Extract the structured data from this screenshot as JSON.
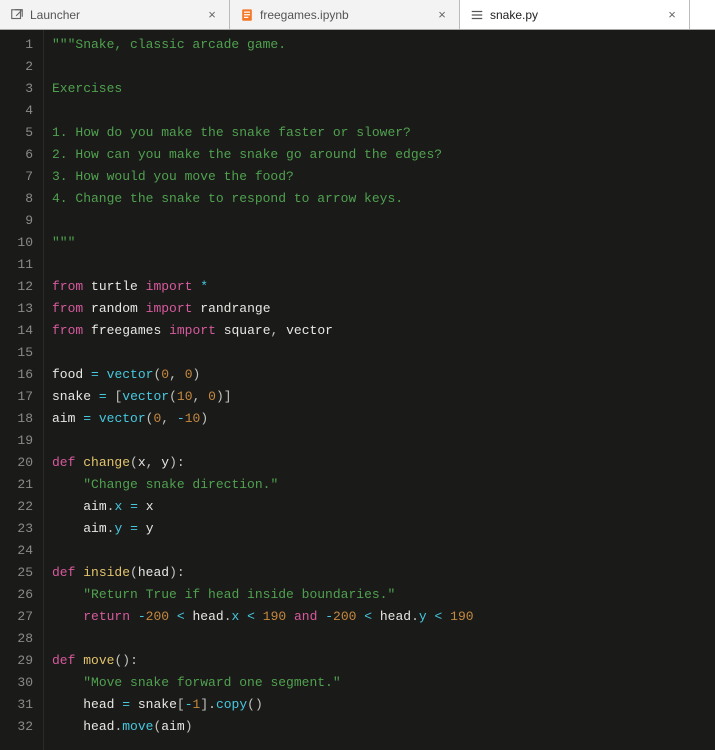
{
  "tabs": [
    {
      "label": "Launcher",
      "iconType": "launcher",
      "active": false
    },
    {
      "label": "freegames.ipynb",
      "iconType": "notebook",
      "active": false
    },
    {
      "label": "snake.py",
      "iconType": "python",
      "active": true
    }
  ],
  "code": {
    "language": "python",
    "lines": [
      {
        "n": 1,
        "tokens": [
          {
            "t": "\"\"\"Snake, classic arcade game.",
            "c": "str"
          }
        ]
      },
      {
        "n": 2,
        "tokens": []
      },
      {
        "n": 3,
        "tokens": [
          {
            "t": "Exercises",
            "c": "str"
          }
        ]
      },
      {
        "n": 4,
        "tokens": []
      },
      {
        "n": 5,
        "tokens": [
          {
            "t": "1. How do you make the snake faster or slower?",
            "c": "str"
          }
        ]
      },
      {
        "n": 6,
        "tokens": [
          {
            "t": "2. How can you make the snake go around the edges?",
            "c": "str"
          }
        ]
      },
      {
        "n": 7,
        "tokens": [
          {
            "t": "3. How would you move the food?",
            "c": "str"
          }
        ]
      },
      {
        "n": 8,
        "tokens": [
          {
            "t": "4. Change the snake to respond to arrow keys.",
            "c": "str"
          }
        ]
      },
      {
        "n": 9,
        "tokens": []
      },
      {
        "n": 10,
        "tokens": [
          {
            "t": "\"\"\"",
            "c": "str"
          }
        ]
      },
      {
        "n": 11,
        "tokens": []
      },
      {
        "n": 12,
        "tokens": [
          {
            "t": "from",
            "c": "kw"
          },
          {
            "t": " ",
            "c": ""
          },
          {
            "t": "turtle",
            "c": "mod"
          },
          {
            "t": " ",
            "c": ""
          },
          {
            "t": "import",
            "c": "kw"
          },
          {
            "t": " ",
            "c": ""
          },
          {
            "t": "*",
            "c": "op"
          }
        ]
      },
      {
        "n": 13,
        "tokens": [
          {
            "t": "from",
            "c": "kw"
          },
          {
            "t": " ",
            "c": ""
          },
          {
            "t": "random",
            "c": "mod"
          },
          {
            "t": " ",
            "c": ""
          },
          {
            "t": "import",
            "c": "kw"
          },
          {
            "t": " ",
            "c": ""
          },
          {
            "t": "randrange",
            "c": "mod"
          }
        ]
      },
      {
        "n": 14,
        "tokens": [
          {
            "t": "from",
            "c": "kw"
          },
          {
            "t": " ",
            "c": ""
          },
          {
            "t": "freegames",
            "c": "mod"
          },
          {
            "t": " ",
            "c": ""
          },
          {
            "t": "import",
            "c": "kw"
          },
          {
            "t": " ",
            "c": ""
          },
          {
            "t": "square",
            "c": "mod"
          },
          {
            "t": ",",
            "c": "punc"
          },
          {
            "t": " ",
            "c": ""
          },
          {
            "t": "vector",
            "c": "mod"
          }
        ]
      },
      {
        "n": 15,
        "tokens": []
      },
      {
        "n": 16,
        "tokens": [
          {
            "t": "food",
            "c": "var"
          },
          {
            "t": " ",
            "c": ""
          },
          {
            "t": "=",
            "c": "op"
          },
          {
            "t": " ",
            "c": ""
          },
          {
            "t": "vector",
            "c": "call"
          },
          {
            "t": "(",
            "c": "punc"
          },
          {
            "t": "0",
            "c": "num"
          },
          {
            "t": ",",
            "c": "punc"
          },
          {
            "t": " ",
            "c": ""
          },
          {
            "t": "0",
            "c": "num"
          },
          {
            "t": ")",
            "c": "punc"
          }
        ]
      },
      {
        "n": 17,
        "tokens": [
          {
            "t": "snake",
            "c": "var"
          },
          {
            "t": " ",
            "c": ""
          },
          {
            "t": "=",
            "c": "op"
          },
          {
            "t": " ",
            "c": ""
          },
          {
            "t": "[",
            "c": "punc"
          },
          {
            "t": "vector",
            "c": "call"
          },
          {
            "t": "(",
            "c": "punc"
          },
          {
            "t": "10",
            "c": "num"
          },
          {
            "t": ",",
            "c": "punc"
          },
          {
            "t": " ",
            "c": ""
          },
          {
            "t": "0",
            "c": "num"
          },
          {
            "t": ")",
            "c": "punc"
          },
          {
            "t": "]",
            "c": "punc"
          }
        ]
      },
      {
        "n": 18,
        "tokens": [
          {
            "t": "aim",
            "c": "var"
          },
          {
            "t": " ",
            "c": ""
          },
          {
            "t": "=",
            "c": "op"
          },
          {
            "t": " ",
            "c": ""
          },
          {
            "t": "vector",
            "c": "call"
          },
          {
            "t": "(",
            "c": "punc"
          },
          {
            "t": "0",
            "c": "num"
          },
          {
            "t": ",",
            "c": "punc"
          },
          {
            "t": " ",
            "c": ""
          },
          {
            "t": "-",
            "c": "op"
          },
          {
            "t": "10",
            "c": "num"
          },
          {
            "t": ")",
            "c": "punc"
          }
        ]
      },
      {
        "n": 19,
        "tokens": []
      },
      {
        "n": 20,
        "tokens": [
          {
            "t": "def",
            "c": "def"
          },
          {
            "t": " ",
            "c": ""
          },
          {
            "t": "change",
            "c": "fn"
          },
          {
            "t": "(",
            "c": "punc"
          },
          {
            "t": "x",
            "c": "var"
          },
          {
            "t": ",",
            "c": "punc"
          },
          {
            "t": " ",
            "c": ""
          },
          {
            "t": "y",
            "c": "var"
          },
          {
            "t": ")",
            "c": "punc"
          },
          {
            "t": ":",
            "c": "punc"
          }
        ]
      },
      {
        "n": 21,
        "tokens": [
          {
            "t": "    ",
            "c": ""
          },
          {
            "t": "\"Change snake direction.\"",
            "c": "str"
          }
        ]
      },
      {
        "n": 22,
        "tokens": [
          {
            "t": "    ",
            "c": ""
          },
          {
            "t": "aim",
            "c": "var"
          },
          {
            "t": ".",
            "c": "punc"
          },
          {
            "t": "x",
            "c": "prop"
          },
          {
            "t": " ",
            "c": ""
          },
          {
            "t": "=",
            "c": "op"
          },
          {
            "t": " ",
            "c": ""
          },
          {
            "t": "x",
            "c": "var"
          }
        ]
      },
      {
        "n": 23,
        "tokens": [
          {
            "t": "    ",
            "c": ""
          },
          {
            "t": "aim",
            "c": "var"
          },
          {
            "t": ".",
            "c": "punc"
          },
          {
            "t": "y",
            "c": "prop"
          },
          {
            "t": " ",
            "c": ""
          },
          {
            "t": "=",
            "c": "op"
          },
          {
            "t": " ",
            "c": ""
          },
          {
            "t": "y",
            "c": "var"
          }
        ]
      },
      {
        "n": 24,
        "tokens": []
      },
      {
        "n": 25,
        "tokens": [
          {
            "t": "def",
            "c": "def"
          },
          {
            "t": " ",
            "c": ""
          },
          {
            "t": "inside",
            "c": "fn"
          },
          {
            "t": "(",
            "c": "punc"
          },
          {
            "t": "head",
            "c": "var"
          },
          {
            "t": ")",
            "c": "punc"
          },
          {
            "t": ":",
            "c": "punc"
          }
        ]
      },
      {
        "n": 26,
        "tokens": [
          {
            "t": "    ",
            "c": ""
          },
          {
            "t": "\"Return True if head inside boundaries.\"",
            "c": "str"
          }
        ]
      },
      {
        "n": 27,
        "tokens": [
          {
            "t": "    ",
            "c": ""
          },
          {
            "t": "return",
            "c": "kw"
          },
          {
            "t": " ",
            "c": ""
          },
          {
            "t": "-",
            "c": "op"
          },
          {
            "t": "200",
            "c": "num"
          },
          {
            "t": " ",
            "c": ""
          },
          {
            "t": "<",
            "c": "op"
          },
          {
            "t": " ",
            "c": ""
          },
          {
            "t": "head",
            "c": "var"
          },
          {
            "t": ".",
            "c": "punc"
          },
          {
            "t": "x",
            "c": "prop"
          },
          {
            "t": " ",
            "c": ""
          },
          {
            "t": "<",
            "c": "op"
          },
          {
            "t": " ",
            "c": ""
          },
          {
            "t": "190",
            "c": "num"
          },
          {
            "t": " ",
            "c": ""
          },
          {
            "t": "and",
            "c": "kw"
          },
          {
            "t": " ",
            "c": ""
          },
          {
            "t": "-",
            "c": "op"
          },
          {
            "t": "200",
            "c": "num"
          },
          {
            "t": " ",
            "c": ""
          },
          {
            "t": "<",
            "c": "op"
          },
          {
            "t": " ",
            "c": ""
          },
          {
            "t": "head",
            "c": "var"
          },
          {
            "t": ".",
            "c": "punc"
          },
          {
            "t": "y",
            "c": "prop"
          },
          {
            "t": " ",
            "c": ""
          },
          {
            "t": "<",
            "c": "op"
          },
          {
            "t": " ",
            "c": ""
          },
          {
            "t": "190",
            "c": "num"
          }
        ]
      },
      {
        "n": 28,
        "tokens": []
      },
      {
        "n": 29,
        "tokens": [
          {
            "t": "def",
            "c": "def"
          },
          {
            "t": " ",
            "c": ""
          },
          {
            "t": "move",
            "c": "fn"
          },
          {
            "t": "(",
            "c": "punc"
          },
          {
            "t": ")",
            "c": "punc"
          },
          {
            "t": ":",
            "c": "punc"
          }
        ]
      },
      {
        "n": 30,
        "tokens": [
          {
            "t": "    ",
            "c": ""
          },
          {
            "t": "\"Move snake forward one segment.\"",
            "c": "str"
          }
        ]
      },
      {
        "n": 31,
        "tokens": [
          {
            "t": "    ",
            "c": ""
          },
          {
            "t": "head",
            "c": "var"
          },
          {
            "t": " ",
            "c": ""
          },
          {
            "t": "=",
            "c": "op"
          },
          {
            "t": " ",
            "c": ""
          },
          {
            "t": "snake",
            "c": "var"
          },
          {
            "t": "[",
            "c": "punc"
          },
          {
            "t": "-",
            "c": "op"
          },
          {
            "t": "1",
            "c": "num"
          },
          {
            "t": "]",
            "c": "punc"
          },
          {
            "t": ".",
            "c": "punc"
          },
          {
            "t": "copy",
            "c": "call"
          },
          {
            "t": "(",
            "c": "punc"
          },
          {
            "t": ")",
            "c": "punc"
          }
        ]
      },
      {
        "n": 32,
        "tokens": [
          {
            "t": "    ",
            "c": ""
          },
          {
            "t": "head",
            "c": "var"
          },
          {
            "t": ".",
            "c": "punc"
          },
          {
            "t": "move",
            "c": "call"
          },
          {
            "t": "(",
            "c": "punc"
          },
          {
            "t": "aim",
            "c": "var"
          },
          {
            "t": ")",
            "c": "punc"
          }
        ]
      }
    ]
  }
}
